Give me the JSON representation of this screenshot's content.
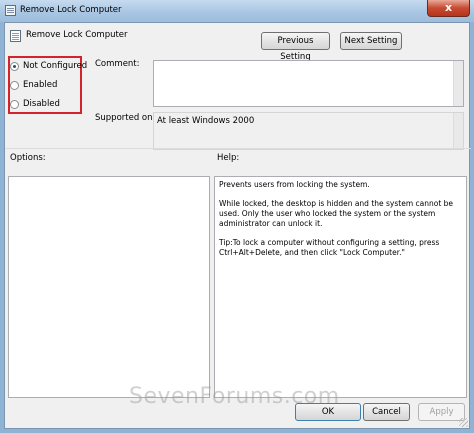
{
  "window": {
    "title": "Remove Lock Computer",
    "close_glyph": "x"
  },
  "header": {
    "policy_name": "Remove Lock Computer",
    "previous_label": "Previous Setting",
    "next_label": "Next Setting"
  },
  "state": {
    "options": [
      {
        "label": "Not Configured",
        "selected": true
      },
      {
        "label": "Enabled",
        "selected": false
      },
      {
        "label": "Disabled",
        "selected": false
      }
    ],
    "highlight_color": "#d3232b"
  },
  "comment": {
    "label": "Comment:",
    "value": ""
  },
  "supported": {
    "label": "Supported on:",
    "value": "At least Windows 2000"
  },
  "options_pane": {
    "label": "Options:"
  },
  "help_pane": {
    "label": "Help:",
    "paragraphs": [
      "Prevents users from locking the system.",
      "While locked, the desktop is hidden and the system cannot be used. Only the user who locked the system or the system administrator can unlock it.",
      "Tip:To lock a computer without configuring a setting, press Ctrl+Alt+Delete, and then click \"Lock Computer.\""
    ]
  },
  "footer": {
    "ok_label": "OK",
    "cancel_label": "Cancel",
    "apply_label": "Apply"
  },
  "watermark": "SevenForums.com"
}
